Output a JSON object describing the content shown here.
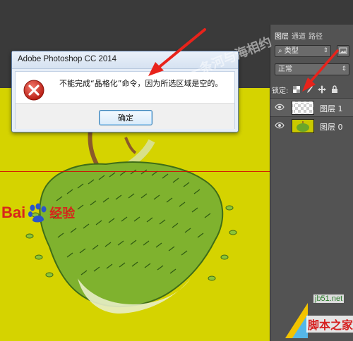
{
  "dialog": {
    "title": "Adobe Photoshop CC 2014",
    "message": "不能完成“晶格化”命令，因为所选区域是空的。",
    "ok_label": "确定"
  },
  "layers_panel": {
    "tabs": [
      {
        "label": "图层",
        "active": true
      },
      {
        "label": "通道",
        "active": false
      },
      {
        "label": "路径",
        "active": false
      }
    ],
    "filter_kind": "类型",
    "blend_mode": "正常",
    "lock_label": "锁定:",
    "layers": [
      {
        "name": "图层 1",
        "selected": true,
        "thumbnail": "transparent"
      },
      {
        "name": "图层 0",
        "selected": false,
        "thumbnail": "tree"
      }
    ]
  },
  "canvas": {
    "background_color": "#d5d300",
    "logo_text": "Bai",
    "logo_suffix": "经验"
  },
  "watermarks": {
    "top": "一条河与海相约",
    "site": "jb51.net",
    "name": "脚本之家"
  },
  "colors": {
    "arrow": "#e8231b",
    "guide": "#d40000",
    "error_icon": "#d8251b"
  },
  "icons": {
    "dialog": "error-icon",
    "layer_visibility": "eye-icon"
  }
}
